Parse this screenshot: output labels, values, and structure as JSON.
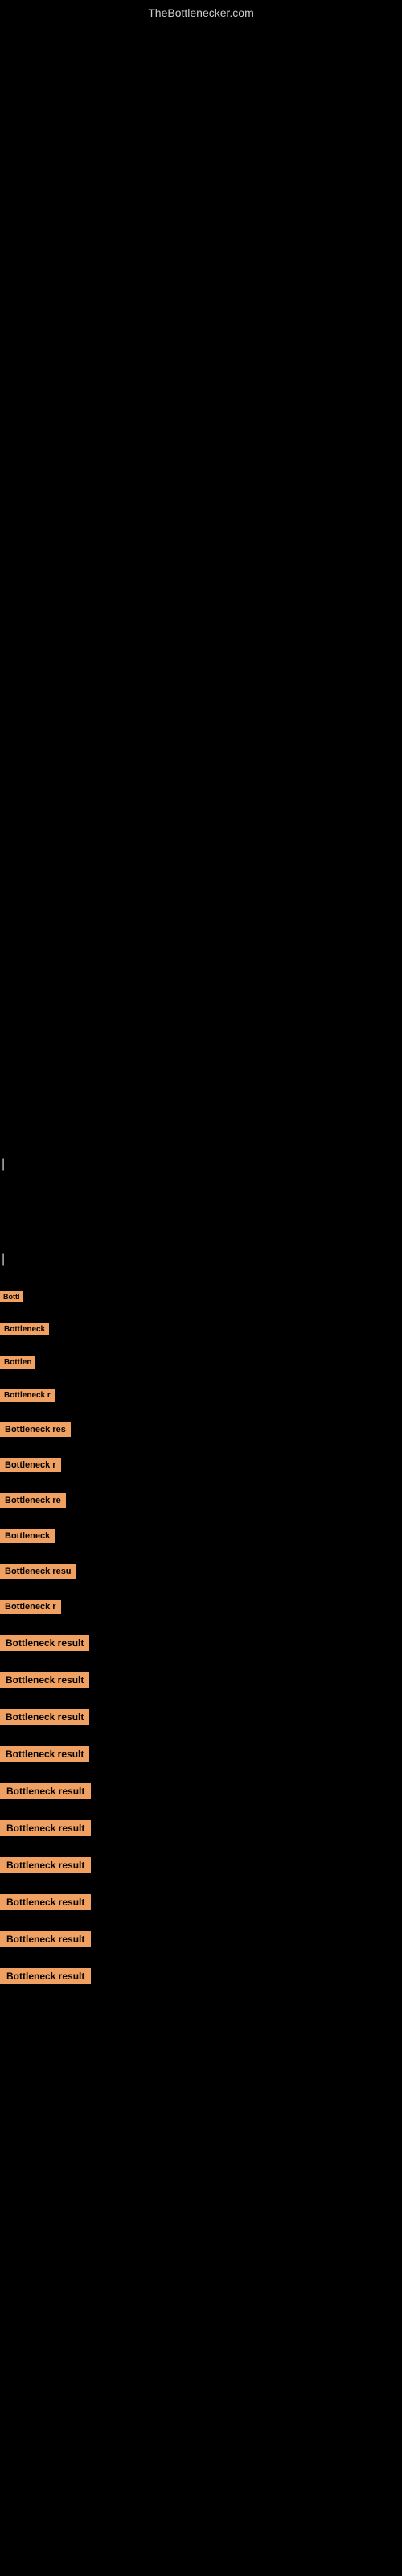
{
  "site": {
    "title": "TheBottlenecker.com"
  },
  "items": [
    {
      "id": 1,
      "label": "Bottl"
    },
    {
      "id": 2,
      "label": "Bottleneck"
    },
    {
      "id": 3,
      "label": "Bottlen"
    },
    {
      "id": 4,
      "label": "Bottleneck r"
    },
    {
      "id": 5,
      "label": "Bottleneck res"
    },
    {
      "id": 6,
      "label": "Bottleneck r"
    },
    {
      "id": 7,
      "label": "Bottleneck re"
    },
    {
      "id": 8,
      "label": "Bottleneck"
    },
    {
      "id": 9,
      "label": "Bottleneck resu"
    },
    {
      "id": 10,
      "label": "Bottleneck r"
    },
    {
      "id": 11,
      "label": "Bottleneck result"
    },
    {
      "id": 12,
      "label": "Bottleneck result"
    },
    {
      "id": 13,
      "label": "Bottleneck result"
    },
    {
      "id": 14,
      "label": "Bottleneck result"
    },
    {
      "id": 15,
      "label": "Bottleneck result"
    },
    {
      "id": 16,
      "label": "Bottleneck result"
    },
    {
      "id": 17,
      "label": "Bottleneck result"
    },
    {
      "id": 18,
      "label": "Bottleneck result"
    },
    {
      "id": 19,
      "label": "Bottleneck result"
    },
    {
      "id": 20,
      "label": "Bottleneck result"
    }
  ]
}
